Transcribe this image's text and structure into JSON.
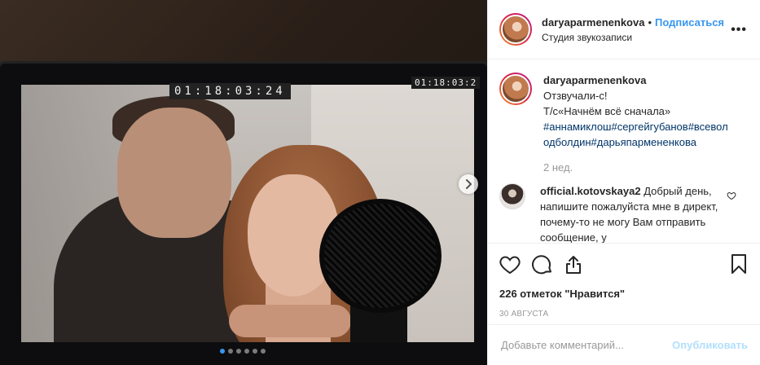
{
  "post": {
    "username": "daryaparmenenkova",
    "bullet": "•",
    "follow_label": "Подписаться",
    "location": "Студия звукозаписи",
    "more_label": "•••",
    "media": {
      "timecode_main": "01:18:03:24",
      "timecode_small": "01:18:03:2",
      "next_icon": "chevron-right-icon",
      "carousel_dots": 6,
      "active_dot": 0
    },
    "caption": {
      "username": "daryaparmenenkova",
      "line1": "Отзвучали-с!",
      "line2": "Т/с«Начнём всё сначала»",
      "hashtags": "#аннамиклош#сергейгубанов#всеволодболдин#дарьяпармененкова",
      "time_ago": "2 нед."
    },
    "comments": [
      {
        "username": "official.kotovskaya2",
        "text": "Добрый день, напишите пожалуйста мне в директ, почему-то не могу Вам отправить сообщение, у"
      }
    ],
    "actions": {
      "like_icon": "heart-icon",
      "comment_icon": "comment-icon",
      "share_icon": "share-icon",
      "save_icon": "bookmark-icon"
    },
    "likes_text": "226 отметок \"Нравится\"",
    "date": "30 августа",
    "add_comment": {
      "placeholder": "Добавьте комментарий...",
      "publish_label": "Опубликовать"
    }
  },
  "colors": {
    "accent": "#3897f0",
    "publish_disabled": "#b2dffc",
    "hashtag": "#003569",
    "muted": "#999999"
  }
}
